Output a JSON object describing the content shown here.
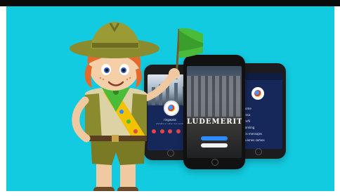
{
  "image": {
    "top_bar_color": "#0b0b0b",
    "background_color": "#12cbe0"
  },
  "phones": {
    "left": {
      "theme_color": "#16285a",
      "username": "ringwaks",
      "subtitle": "planeta a cultur mio verde"
    },
    "center": {
      "title": "LUDEMERITA",
      "primary_button_color": "#2b8cff"
    },
    "right": {
      "menu": [
        "Home",
        "Mesa",
        "Profil",
        "Ranking",
        "Mis mensajes",
        "Quienes somos"
      ]
    }
  },
  "mascot": {
    "description_icon": "scout-girl-with-green-flag-icon",
    "flag_color": "#4bbb3a",
    "hat_color": "#8a8a2f",
    "hair_color": "#e36a2c"
  }
}
